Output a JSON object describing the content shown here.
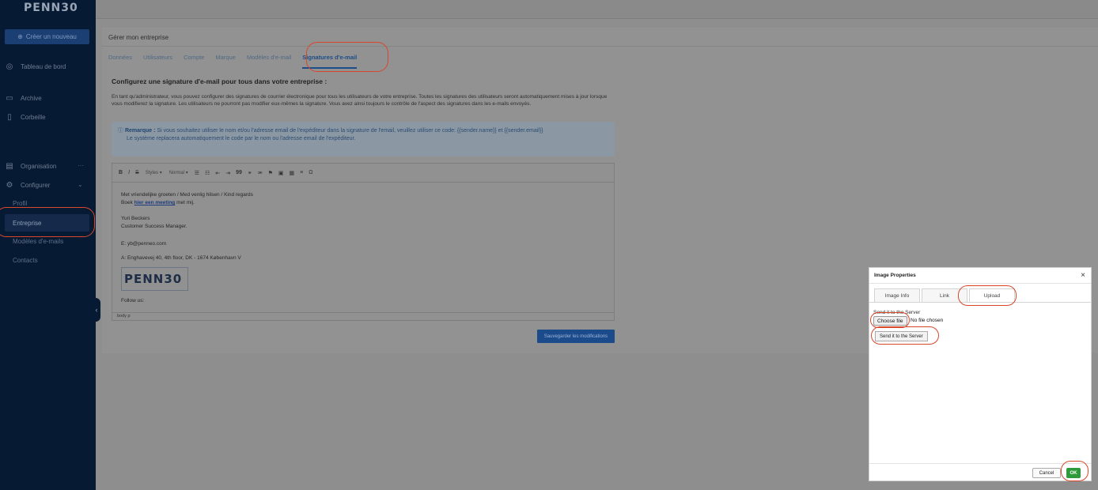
{
  "sidebar": {
    "logo": "PENN30",
    "create_button": "Créer un nouveau",
    "items": [
      {
        "label": "Tableau de bord",
        "icon": "dashboard-icon"
      },
      {
        "label": "Archive",
        "icon": "archive-icon"
      },
      {
        "label": "Corbeille",
        "icon": "trash-icon"
      },
      {
        "label": "Organisation",
        "icon": "building-icon"
      },
      {
        "label": "Configurer",
        "icon": "gear-icon"
      }
    ],
    "sub_items": [
      "Profil",
      "Entreprise",
      "Modèles d'e-mails",
      "Contacts"
    ],
    "more": "···"
  },
  "panel": {
    "title": "Gérer mon entreprise",
    "tabs": [
      "Données",
      "Utilisateurs",
      "Compte",
      "Marque",
      "Modèles d'e-mail",
      "Signatures d'e-mail"
    ],
    "heading": "Configurez une signature d'e-mail pour tous dans votre entreprise :",
    "description": "En tant qu'administrateur, vous pouvez configurer des signatures de courrier électronique pour tous les utilisateurs de votre entreprise. Toutes les signatures des utilisateurs seront automatiquement mises à jour lorsque vous modifierez la signature. Les utilisateurs ne pourront pas modifier eux-mêmes la signature. Vous avez ainsi toujours le contrôle de l'aspect des signatures dans les e-mails envoyés.",
    "note_label": "Remarque :",
    "note_text": "Si vous souhaitez utiliser le nom et/ou l'adresse email de l'expéditeur dans la signature de l'email, veuillez utiliser ce code: {{sender.name}} et {{sender.email}}",
    "note_text2": "Le système replacera automatiquement le code par le nom ou l'adresse email de l'expéditeur.",
    "save_button": "Sauvegarder les modifications"
  },
  "editor": {
    "toolbar": {
      "bold": "B",
      "italic": "I",
      "strike": "S",
      "styles": "Styles",
      "format": "Normal",
      "quote": "99",
      "omega": "Ω"
    },
    "lines": {
      "greeting": "Met vriendelijke groeten / Med venlig hilsen / Kind regards",
      "book_prefix": "Boek ",
      "book_link": "hier een meeting",
      "book_suffix": " met mij.",
      "name": "Yuri Beckers",
      "role": "Customer Success Manager.",
      "email": "E: yb@penneo.com",
      "address": "A: Enghavevej 40, 4th floor, DK - 1674 København V",
      "logo": "PENN30",
      "follow": "Follow us:"
    },
    "status": "body  p"
  },
  "dialog": {
    "title": "Image Properties",
    "close": "×",
    "tabs": [
      "Image Info",
      "Link",
      "Upload"
    ],
    "send_label": "Send it to the Server",
    "choose_file": "Choose file",
    "no_file": "No file chosen",
    "send_button": "Send it to the Server",
    "cancel": "Cancel",
    "ok": "OK"
  }
}
